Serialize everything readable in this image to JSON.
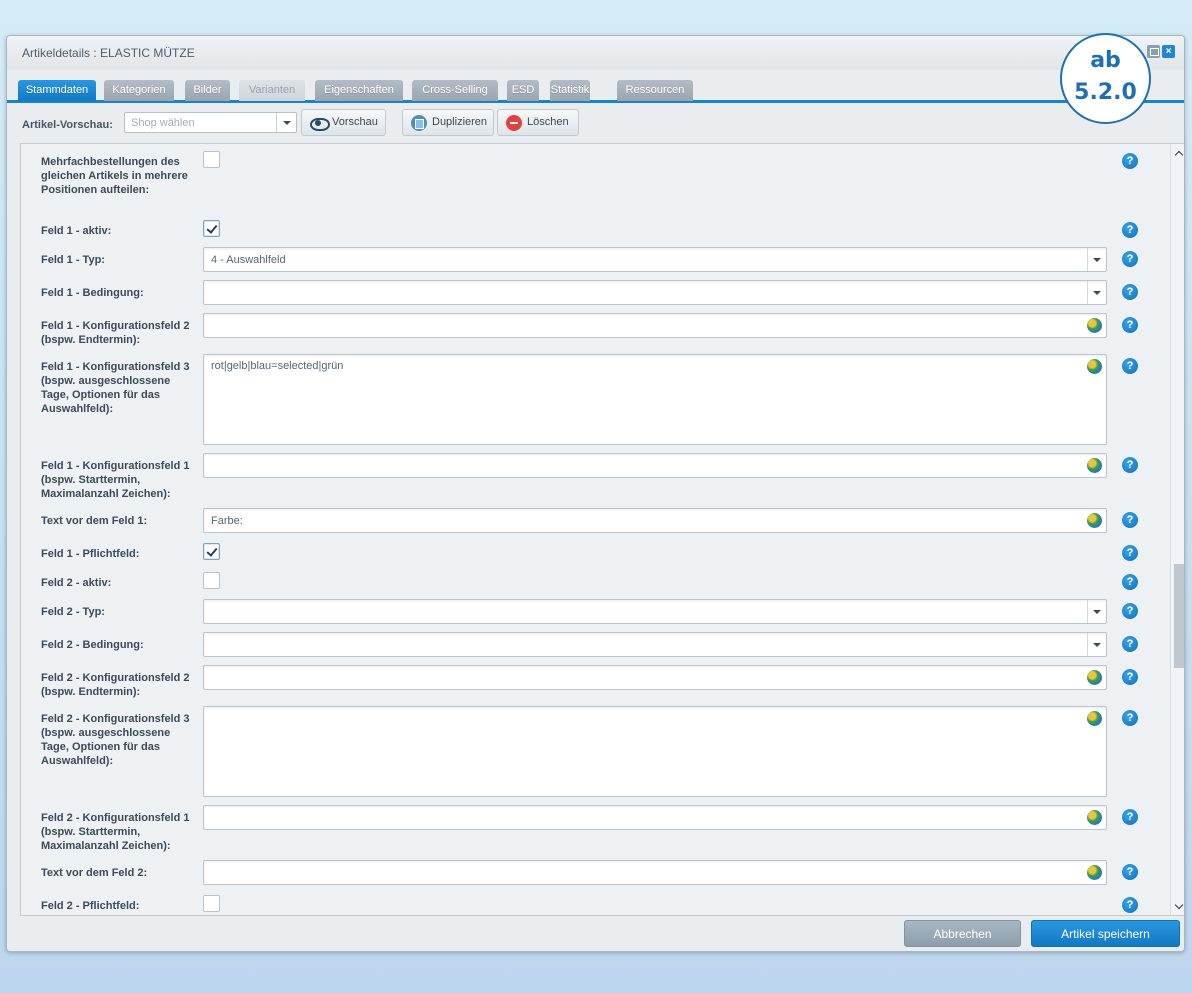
{
  "window": {
    "title": "Artikeldetails : ELASTIC MÜTZE"
  },
  "tabs": [
    {
      "label": "Stammdaten",
      "state": "active"
    },
    {
      "label": "Kategorien",
      "state": "normal"
    },
    {
      "label": "Bilder",
      "state": "normal"
    },
    {
      "label": "Varianten",
      "state": "disabled"
    },
    {
      "label": "Eigenschaften",
      "state": "normal"
    },
    {
      "label": "Cross-Selling",
      "state": "normal"
    },
    {
      "label": "ESD",
      "state": "normal"
    },
    {
      "label": "Statistik",
      "state": "normal"
    },
    {
      "label": "Ressourcen",
      "state": "normal"
    }
  ],
  "toolbar": {
    "preview_label": "Artikel-Vorschau:",
    "shop_placeholder": "Shop wählen",
    "preview_button": "Vorschau",
    "duplicate_button": "Duplizieren",
    "delete_button": "Löschen"
  },
  "form": {
    "rows": [
      {
        "label": "Mehrfachbestellungen des gleichen Artikels in mehrere Positionen aufteilen:",
        "type": "checkbox",
        "checked": false
      },
      {
        "label": "Feld 1 - aktiv:",
        "type": "checkbox",
        "checked": true
      },
      {
        "label": "Feld 1 - Typ:",
        "type": "select",
        "value": "4 - Auswahlfeld"
      },
      {
        "label": "Feld 1 - Bedingung:",
        "type": "select",
        "value": ""
      },
      {
        "label": "Feld 1 - Konfigurationsfeld 2 (bspw. Endtermin):",
        "type": "text",
        "value": ""
      },
      {
        "label": "Feld 1 - Konfigurationsfeld 3 (bspw. ausgeschlossene Tage, Optionen für das Auswahlfeld):",
        "type": "textarea",
        "value": "rot|gelb|blau=selected|grün"
      },
      {
        "label": "Feld 1 - Konfigurationsfeld 1 (bspw. Starttermin, Maximalanzahl Zeichen):",
        "type": "text",
        "value": ""
      },
      {
        "label": "Text vor dem Feld 1:",
        "type": "text",
        "value": "Farbe:"
      },
      {
        "label": "Feld 1 - Pflichtfeld:",
        "type": "checkbox",
        "checked": true
      },
      {
        "label": "Feld 2 - aktiv:",
        "type": "checkbox",
        "checked": false
      },
      {
        "label": "Feld 2 - Typ:",
        "type": "select",
        "value": ""
      },
      {
        "label": "Feld 2 - Bedingung:",
        "type": "select",
        "value": ""
      },
      {
        "label": "Feld 2 - Konfigurationsfeld 2 (bspw. Endtermin):",
        "type": "text",
        "value": ""
      },
      {
        "label": "Feld 2 - Konfigurationsfeld 3 (bspw. ausgeschlossene Tage, Optionen für das Auswahlfeld):",
        "type": "textarea",
        "value": ""
      },
      {
        "label": "Feld 2 - Konfigurationsfeld 1 (bspw. Starttermin, Maximalanzahl Zeichen):",
        "type": "text",
        "value": ""
      },
      {
        "label": "Text vor dem Feld 2:",
        "type": "text",
        "value": ""
      },
      {
        "label": "Feld 2 - Pflichtfeld:",
        "type": "checkbox",
        "checked": false
      }
    ],
    "help_glyph": "?"
  },
  "footer": {
    "cancel_button": "Abbrechen",
    "save_button": "Artikel speichern"
  },
  "badge": {
    "line1": "ab",
    "line2": "5.2.0"
  },
  "colors": {
    "accent": "#1784d0",
    "badge": "#1f6fb2"
  }
}
